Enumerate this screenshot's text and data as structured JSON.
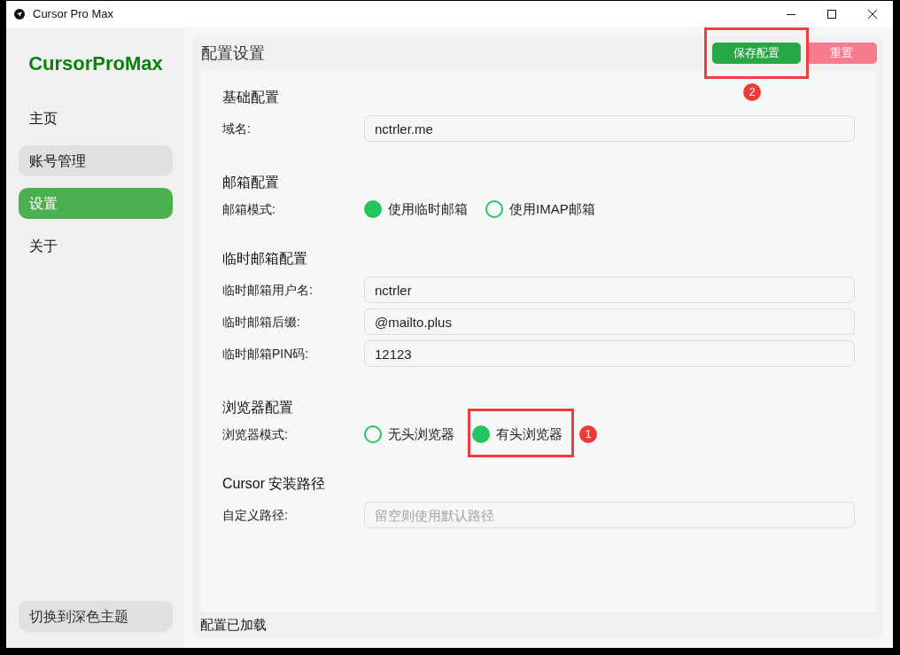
{
  "window": {
    "title": "Cursor Pro Max"
  },
  "sidebar": {
    "logo": "CursorProMax",
    "items": [
      {
        "label": "主页",
        "selected": false,
        "hovered": false
      },
      {
        "label": "账号管理",
        "selected": false,
        "hovered": true
      },
      {
        "label": "设置",
        "selected": true,
        "hovered": false
      },
      {
        "label": "关于",
        "selected": false,
        "hovered": false
      }
    ],
    "theme_button": "切换到深色主题"
  },
  "main": {
    "title": "配置设置",
    "buttons": [
      {
        "label": "保存配置",
        "kind": "primary",
        "annotation": "2"
      },
      {
        "label": "重置",
        "kind": "danger"
      }
    ],
    "sections": [
      {
        "heading": "基础配置",
        "rows": [
          {
            "kind": "input",
            "label": "域名:",
            "value": "nctrler.me"
          }
        ]
      },
      {
        "heading": "邮箱配置",
        "rows": [
          {
            "kind": "radio",
            "label": "邮箱模式:",
            "options": [
              {
                "label": "使用临时邮箱",
                "selected": true
              },
              {
                "label": "使用IMAP邮箱",
                "selected": false
              }
            ]
          }
        ]
      },
      {
        "heading": "临时邮箱配置",
        "rows": [
          {
            "kind": "input",
            "label": "临时邮箱用户名:",
            "value": "nctrler"
          },
          {
            "kind": "input",
            "label": "临时邮箱后缀:",
            "value": "@mailto.plus"
          },
          {
            "kind": "input",
            "label": "临时邮箱PIN码:",
            "value": "12123"
          }
        ]
      },
      {
        "heading": "浏览器配置",
        "rows": [
          {
            "kind": "radio",
            "label": "浏览器模式:",
            "options": [
              {
                "label": "无头浏览器",
                "selected": false
              },
              {
                "label": "有头浏览器",
                "selected": true,
                "annotation": "1"
              }
            ]
          }
        ]
      },
      {
        "heading": "Cursor 安装路径",
        "rows": [
          {
            "kind": "input",
            "label": "自定义路径:",
            "placeholder": "留空则使用默认路径"
          }
        ]
      }
    ],
    "status": "配置已加载"
  }
}
